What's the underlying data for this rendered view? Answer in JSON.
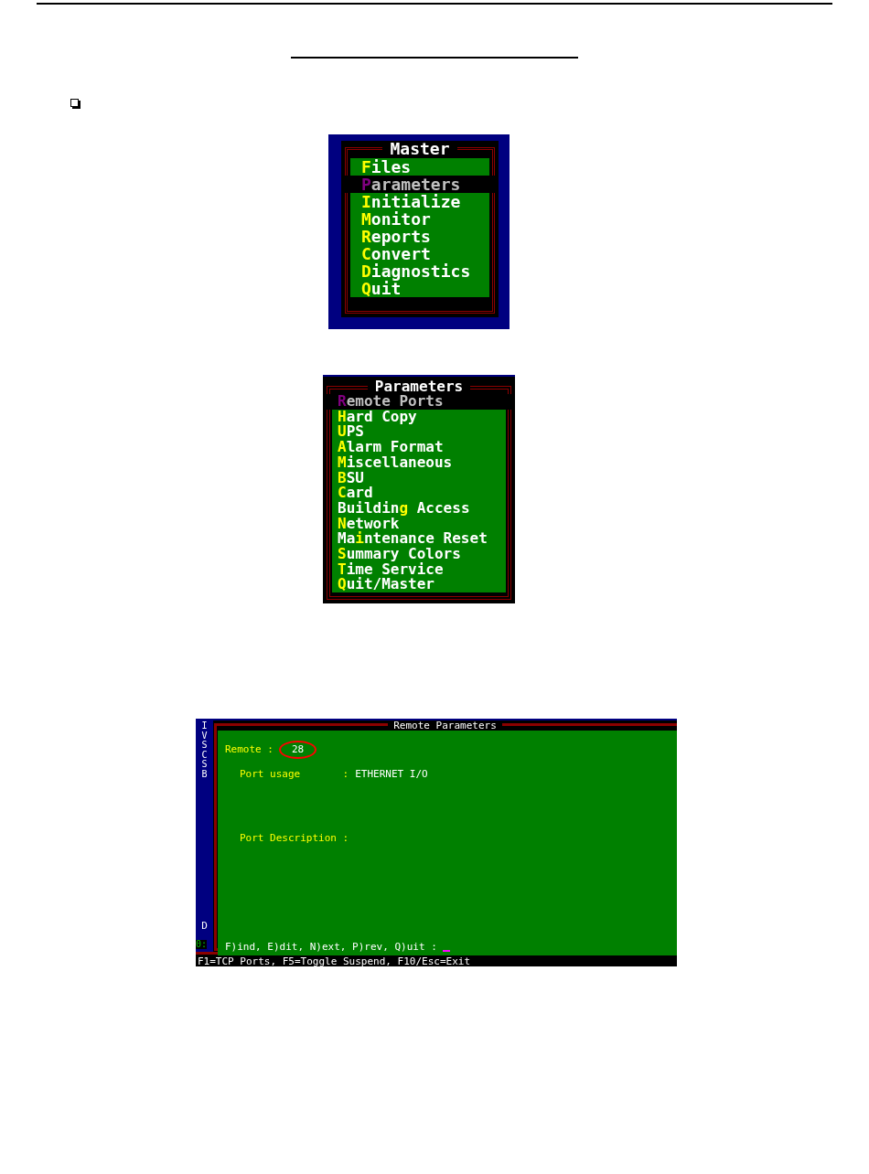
{
  "master_menu": {
    "title": "Master",
    "items": [
      {
        "key": "F",
        "post": "iles",
        "selected": false
      },
      {
        "key": "P",
        "post": "arameters",
        "selected": true
      },
      {
        "key": "I",
        "post": "nitialize",
        "selected": false
      },
      {
        "key": "M",
        "post": "onitor",
        "selected": false
      },
      {
        "key": "R",
        "post": "eports",
        "selected": false
      },
      {
        "key": "C",
        "post": "onvert",
        "selected": false
      },
      {
        "key": "D",
        "post": "iagnostics",
        "selected": false
      },
      {
        "key": "Q",
        "post": "uit",
        "selected": false
      }
    ]
  },
  "parameters_menu": {
    "title": "Parameters",
    "items": [
      {
        "key": "R",
        "post": "emote Ports",
        "selected": true
      },
      {
        "key": "H",
        "post": "ard Copy",
        "selected": false
      },
      {
        "key": "U",
        "post": "PS",
        "selected": false
      },
      {
        "key": "A",
        "post": "larm Format",
        "selected": false
      },
      {
        "key": "M",
        "post": "iscellaneous",
        "selected": false
      },
      {
        "key": "B",
        "post": "SU",
        "selected": false
      },
      {
        "key": "C",
        "post": "ard",
        "selected": false
      },
      {
        "pre": "Buildin",
        "key": "g",
        "post": " Access",
        "selected": false
      },
      {
        "key": "N",
        "post": "etwork",
        "selected": false
      },
      {
        "pre": "Ma",
        "key": "i",
        "post": "ntenance Reset",
        "selected": false
      },
      {
        "key": "S",
        "post": "ummary Colors",
        "selected": false
      },
      {
        "key": "T",
        "post": "ime Service",
        "selected": false
      },
      {
        "key": "Q",
        "post": "uit/Master",
        "selected": false
      }
    ]
  },
  "remote_screen": {
    "side_letters": [
      "I",
      "V",
      "S",
      "C",
      "S",
      "B"
    ],
    "side_bottom_letter": "D",
    "side_prompt": "0:",
    "title": "Remote Parameters",
    "remote_label": "Remote :",
    "remote_value": "28",
    "fields": [
      {
        "label": "Port usage       :",
        "value": "ETHERNET I/O"
      },
      {
        "label": "Port Description :"
      }
    ],
    "command_prompt": "F)ind, E)dit, N)ext, P)rev, Q)uit :",
    "status_bar": "F1=TCP Ports, F5=Toggle Suspend, F10/Esc=Exit"
  }
}
